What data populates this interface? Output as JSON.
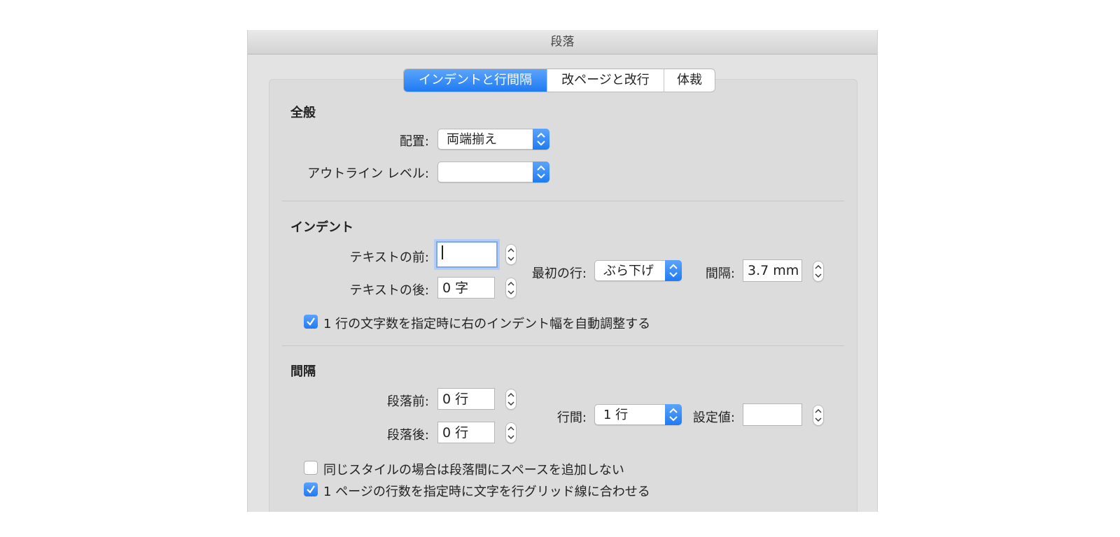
{
  "window": {
    "title": "段落"
  },
  "tabs": [
    {
      "label": "インデントと行間隔",
      "active": true
    },
    {
      "label": "改ページと改行",
      "active": false
    },
    {
      "label": "体裁",
      "active": false
    }
  ],
  "general": {
    "title": "全般",
    "alignment": {
      "label": "配置:",
      "value": "両端揃え"
    },
    "outline_level": {
      "label": "アウトライン レベル:",
      "value": ""
    }
  },
  "indent": {
    "title": "インデント",
    "before_text": {
      "label": "テキストの前:",
      "value": ""
    },
    "after_text": {
      "label": "テキストの後:",
      "value": "0 字"
    },
    "first_line": {
      "label": "最初の行:",
      "value": "ぶら下げ"
    },
    "by": {
      "label": "間隔:",
      "value": "3.7 mm"
    },
    "auto_adjust": {
      "label": "1 行の文字数を指定時に右のインデント幅を自動調整する",
      "checked": true
    }
  },
  "spacing": {
    "title": "間隔",
    "before": {
      "label": "段落前:",
      "value": "0 行"
    },
    "after": {
      "label": "段落後:",
      "value": "0 行"
    },
    "line_spacing": {
      "label": "行間:",
      "value": "1 行"
    },
    "at": {
      "label": "設定値:",
      "value": ""
    },
    "no_space_same_style": {
      "label": "同じスタイルの場合は段落間にスペースを追加しない",
      "checked": false
    },
    "snap_to_grid": {
      "label": "1 ページの行数を指定時に文字を行グリッド線に合わせる",
      "checked": true
    }
  },
  "colors": {
    "accent": "#1f7bf2",
    "panel": "#dcdcdc"
  }
}
